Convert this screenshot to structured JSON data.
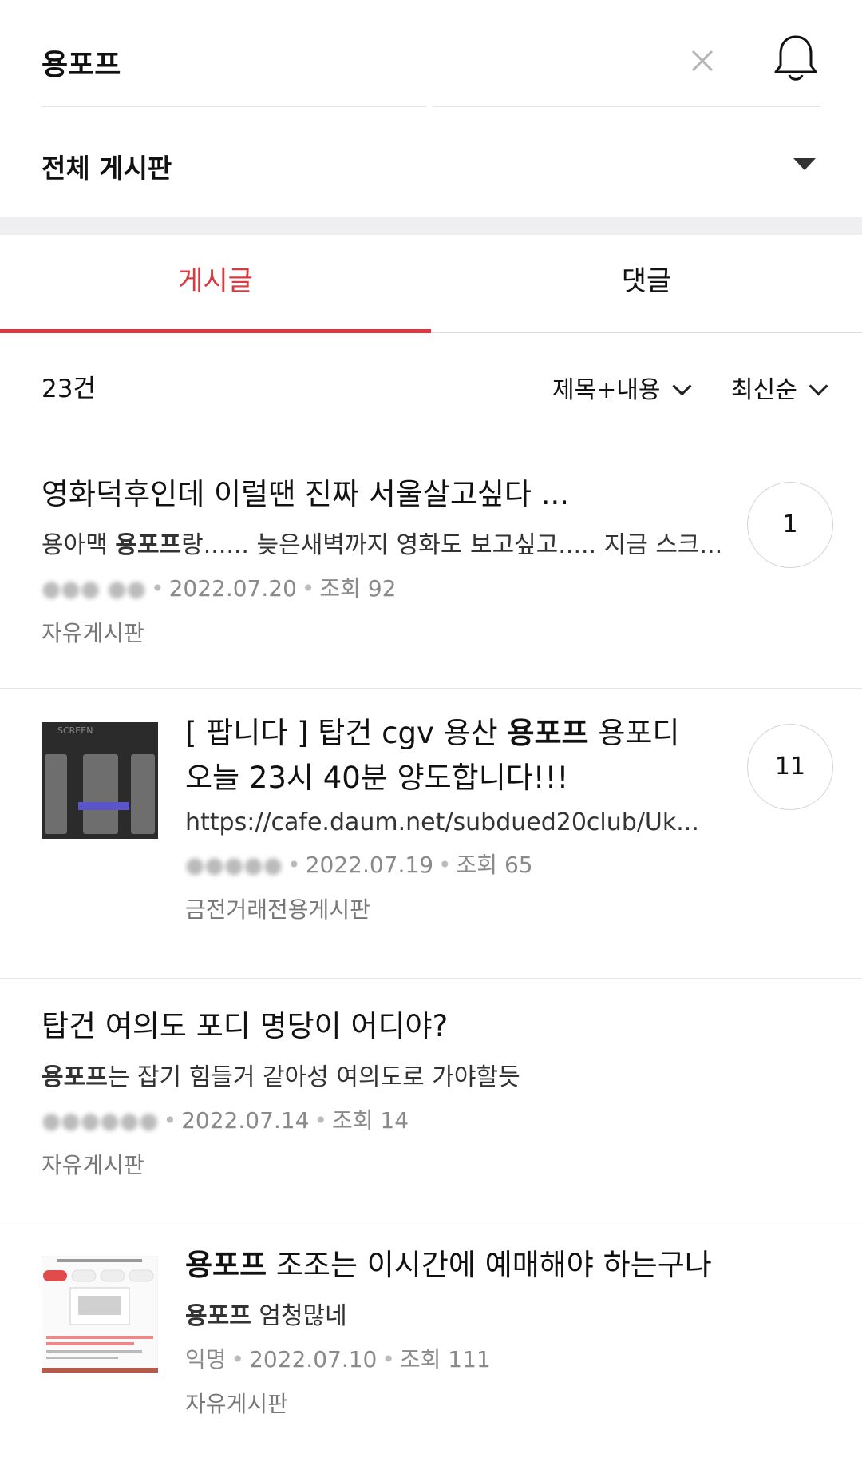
{
  "search": {
    "query": "용포프"
  },
  "board_selector": {
    "label": "전체 게시판"
  },
  "tabs": [
    {
      "label": "게시글"
    },
    {
      "label": "댓글"
    }
  ],
  "results": {
    "count": "23건",
    "filter_label": "제목+내용",
    "sort_label": "최신순"
  },
  "posts": [
    {
      "title": "영화덕후인데 이럴땐 진짜 서울살고싶다 ...",
      "snippet_prefix": "용아맥 ",
      "snippet_highlight": "용포프",
      "snippet_suffix": "랑...... 늦은새벽까지 영화도 보고싶고..... 지금 스크...",
      "author": "",
      "date": "2022.07.20",
      "views": "조회 92",
      "board": "자유게시판",
      "comments": "1"
    },
    {
      "title_prefix": "[ 팝니다 ] 탑건 cgv 용산 ",
      "title_highlight": "용포프",
      "title_suffix": " 용포디 오늘 23시 40분 양도합니다!!!",
      "snippet": "https://cafe.daum.net/subdued20club/Uk...",
      "author": "",
      "date": "2022.07.19",
      "views": "조회 65",
      "board": "금전거래전용게시판",
      "comments": "11",
      "thumb_caption": "SCREEN"
    },
    {
      "title": "탑건 여의도 포디 명당이 어디야?",
      "snippet_highlight": "용포프",
      "snippet_suffix": "는 잡기 힘들거 같아성 여의도로 가야할듯",
      "author": "",
      "date": "2022.07.14",
      "views": "조회 14",
      "board": "자유게시판"
    },
    {
      "title_highlight": "용포프",
      "title_suffix": " 조조는 이시간에 예매해야 하는구나",
      "snippet_highlight": "용포프",
      "snippet_suffix": " 엄청많네",
      "author": "익명",
      "date": "2022.07.10",
      "views": "조회 111",
      "board": "자유게시판"
    }
  ],
  "colors": {
    "accent": "#d83a3f",
    "meta": "#8a8a8a",
    "divider": "#e6e6e6"
  },
  "icons": [
    "close-icon",
    "bell-icon",
    "caret-down-icon",
    "chevron-down-icon"
  ]
}
